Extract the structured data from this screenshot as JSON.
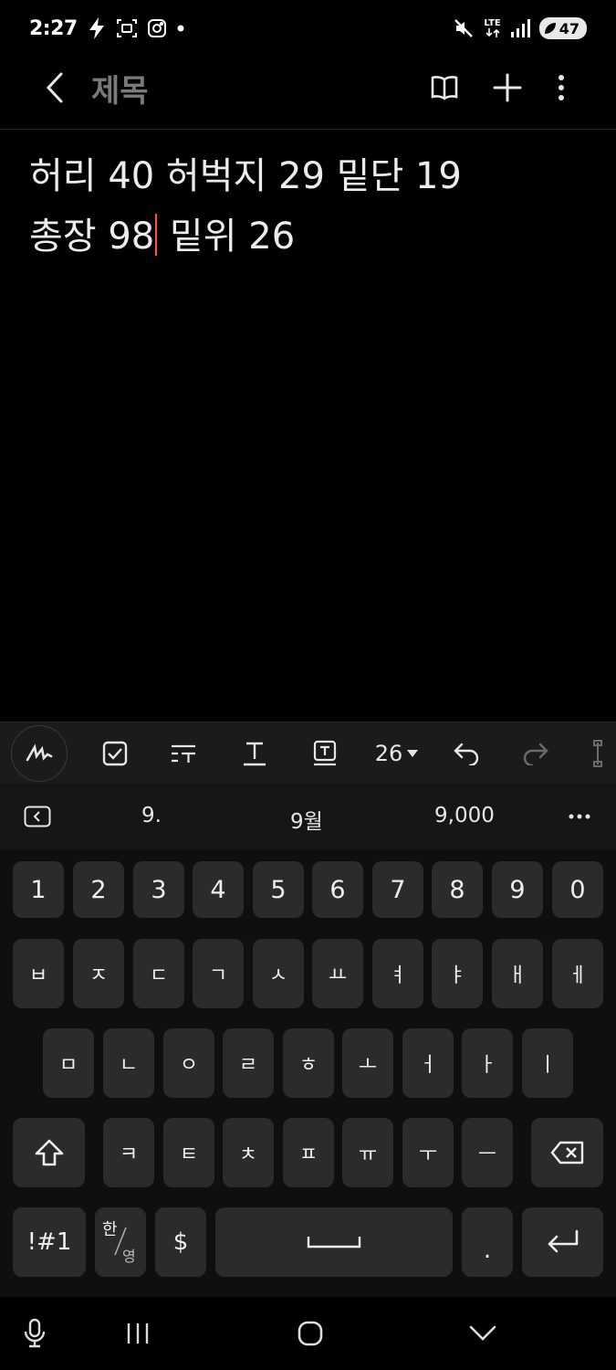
{
  "status_bar": {
    "time": "2:27",
    "network": "LTE",
    "battery": "47"
  },
  "header": {
    "title": "제목"
  },
  "note": {
    "line1": "허리 40 허벅지 29 밑단 19",
    "line2_before_caret": "총장 98",
    "line2_after_caret": " 밑위 26"
  },
  "toolbar": {
    "font_size": "26"
  },
  "suggestions": [
    "9.",
    "9월",
    "9,000"
  ],
  "keyboard": {
    "row_numbers": [
      "1",
      "2",
      "3",
      "4",
      "5",
      "6",
      "7",
      "8",
      "9",
      "0"
    ],
    "row1": [
      "ㅂ",
      "ㅈ",
      "ㄷ",
      "ㄱ",
      "ㅅ",
      "ㅛ",
      "ㅕ",
      "ㅑ",
      "ㅐ",
      "ㅔ"
    ],
    "row2": [
      "ㅁ",
      "ㄴ",
      "ㅇ",
      "ㄹ",
      "ㅎ",
      "ㅗ",
      "ㅓ",
      "ㅏ",
      "ㅣ"
    ],
    "row3": [
      "ㅋ",
      "ㅌ",
      "ㅊ",
      "ㅍ",
      "ㅠ",
      "ㅜ",
      "ㅡ"
    ],
    "symbols_label": "!#1",
    "lang_top": "한",
    "lang_bottom": "영",
    "currency_label": "$",
    "period_label": "."
  },
  "colors": {
    "caret": "#ff5a2c",
    "key": "#2b2b2b",
    "toolbar": "#1b1b1b"
  }
}
